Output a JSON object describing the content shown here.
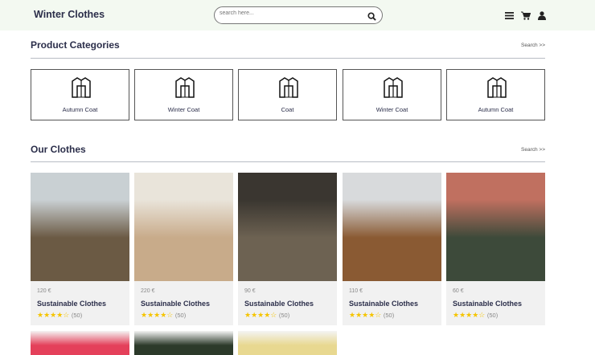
{
  "header": {
    "brand": "Winter Clothes",
    "search_placeholder": "search here..."
  },
  "categories_section": {
    "title": "Product Categories",
    "link": "Search >>",
    "items": [
      {
        "label": "Autumn Coat"
      },
      {
        "label": "Winter Coat"
      },
      {
        "label": "Coat"
      },
      {
        "label": "Winter Coat"
      },
      {
        "label": "Autumn Coat"
      }
    ]
  },
  "clothes_section": {
    "title": "Our Clothes",
    "link": "Search >>",
    "products": [
      {
        "price": "120 €",
        "name": "Sustainable Clothes",
        "rating": 4,
        "stars": "★★★★☆",
        "reviews": "(50)",
        "colors": [
          "#c9d0d3",
          "#6b5a44"
        ]
      },
      {
        "price": "220 €",
        "name": "Sustainable Clothes",
        "rating": 4,
        "stars": "★★★★☆",
        "reviews": "(50)",
        "colors": [
          "#e9e4da",
          "#c8ab8a"
        ]
      },
      {
        "price": "90 €",
        "name": "Sustainable Clothes",
        "rating": 4,
        "stars": "★★★★☆",
        "reviews": "(50)",
        "colors": [
          "#3a3630",
          "#6d6252"
        ]
      },
      {
        "price": "110 €",
        "name": "Sustainable Clothes",
        "rating": 4,
        "stars": "★★★★☆",
        "reviews": "(50)",
        "colors": [
          "#d8dadc",
          "#8a5a33"
        ]
      },
      {
        "price": "60 €",
        "name": "Sustainable Clothes",
        "rating": 4,
        "stars": "★★★★☆",
        "reviews": "(50)",
        "colors": [
          "#c07060",
          "#3d4a3a"
        ]
      }
    ],
    "second_row_colors": [
      "#e4405a",
      "#2c3a2a",
      "#e8d890"
    ]
  }
}
